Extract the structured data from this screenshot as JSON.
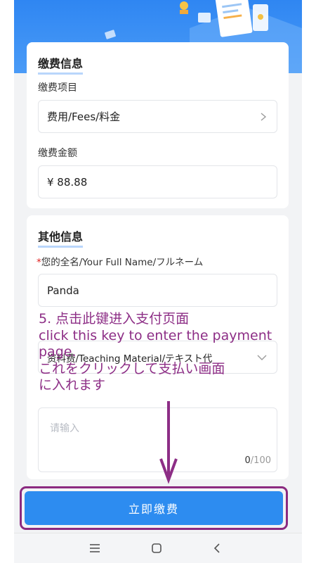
{
  "payment_info": {
    "section_title": "缴费信息",
    "item_label": "缴费项目",
    "item_value": "费用/Fees/料金",
    "amount_label": "缴费金额",
    "amount_value": "¥ 88.88"
  },
  "other_info": {
    "section_title": "其他信息",
    "required_mark": "*",
    "name_label": "您的全名/Your Full Name/フルネーム",
    "name_value": "Panda",
    "material_value": "资料费/Teaching Material/テキスト代",
    "textarea_placeholder": "请输入",
    "char_count_current": "0",
    "char_count_max": "/100"
  },
  "pay_button_label": "立即缴费",
  "annotation": {
    "line1": "5. 点击此键进入支付页面",
    "line2": "click this key to enter the payment",
    "line3": "page.",
    "line4": "これをクリックして支払い画面",
    "line5": "に入れます"
  },
  "navbar": {
    "icons": [
      "menu-icon",
      "home-icon",
      "back-icon"
    ]
  },
  "colors": {
    "accent_blue": "#2d8cf0",
    "annotation_purple": "#8d2e86"
  }
}
